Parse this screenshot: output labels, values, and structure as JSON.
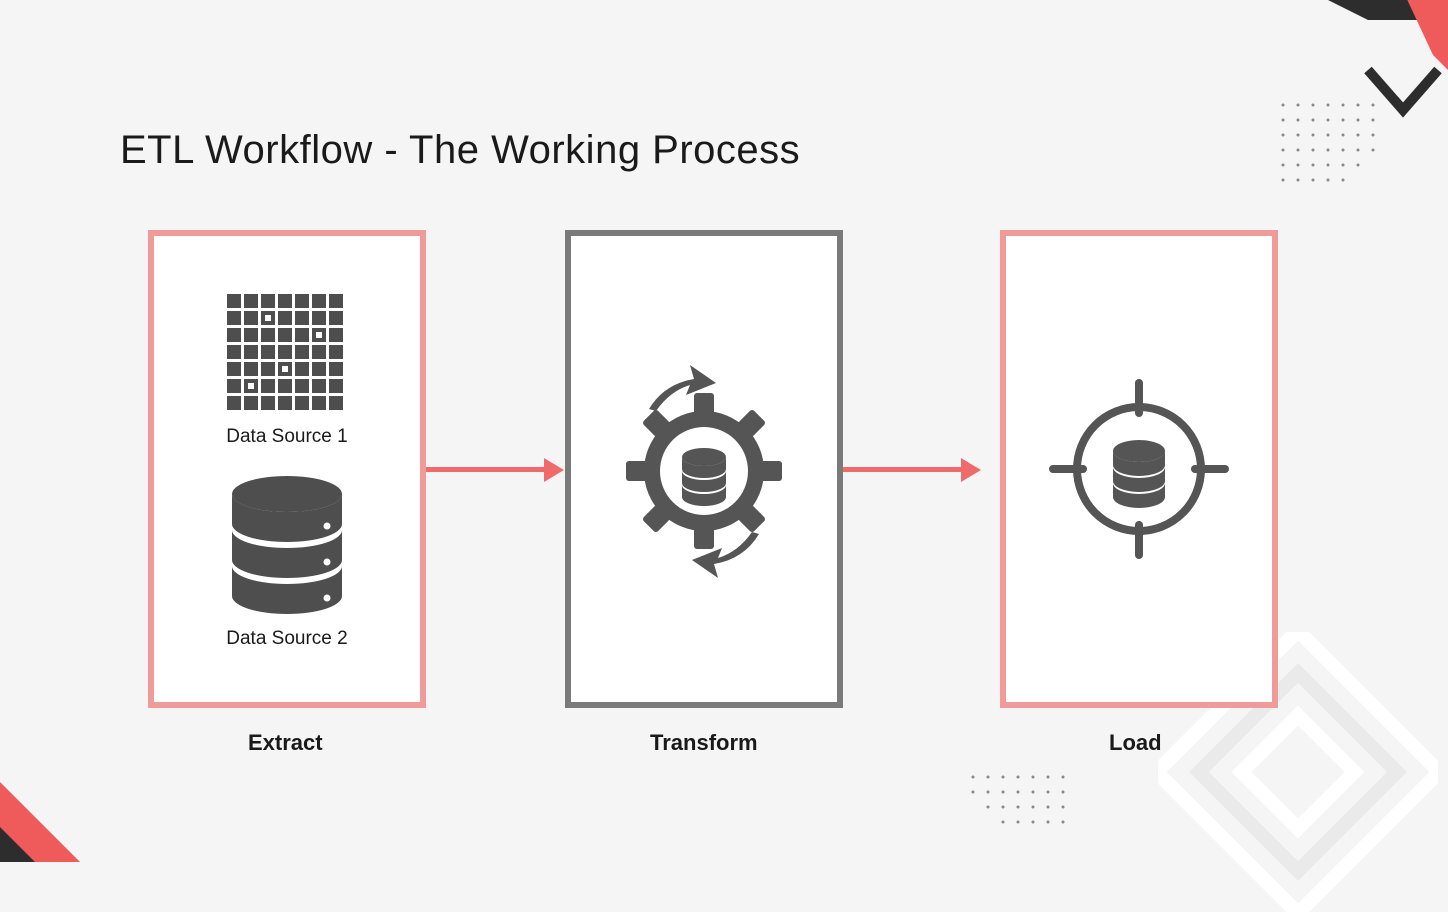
{
  "title": "ETL Workflow - The Working Process",
  "stages": {
    "extract": {
      "label": "Extract",
      "sources": [
        "Data Source 1",
        "Data Source 2"
      ]
    },
    "transform": {
      "label": "Transform"
    },
    "load": {
      "label": "Load"
    }
  },
  "colors": {
    "pink_border": "#f19a9a",
    "gray_border": "#7a7a7a",
    "arrow": "#ef6b6b",
    "dark": "#3a3a3a",
    "icon_gray": "#555555"
  }
}
